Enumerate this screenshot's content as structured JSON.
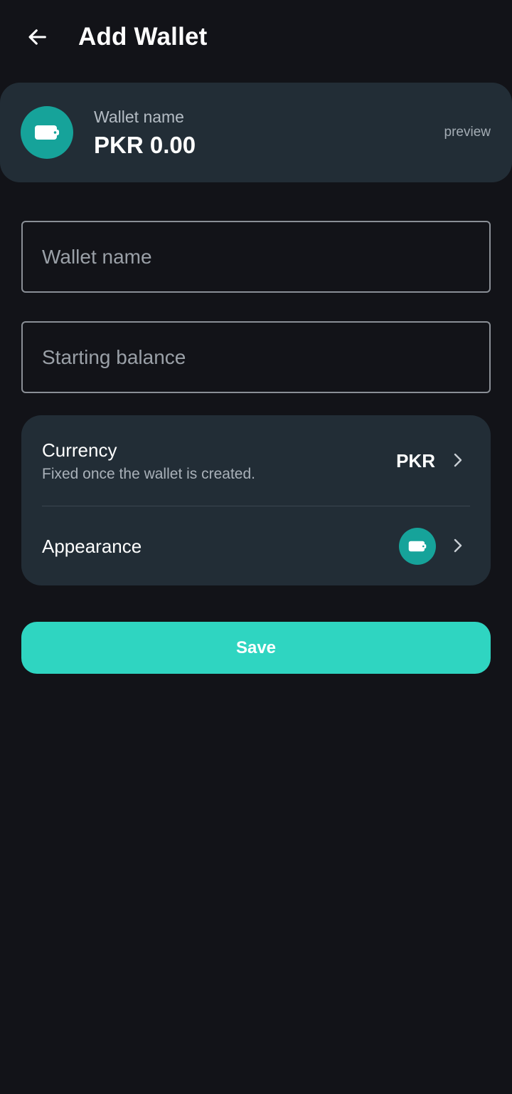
{
  "header": {
    "title": "Add Wallet",
    "back_icon": "arrow-left-icon"
  },
  "preview": {
    "name": "Wallet name",
    "balance": "PKR 0.00",
    "tag": "preview",
    "icon": "wallet-icon",
    "color": "#16a39a"
  },
  "form": {
    "name_placeholder": "Wallet name",
    "name_value": "",
    "balance_placeholder": "Starting balance",
    "balance_value": ""
  },
  "settings": {
    "currency_label": "Currency",
    "currency_hint": "Fixed once the wallet is created.",
    "currency_value": "PKR",
    "appearance_label": "Appearance",
    "appearance_color": "#16a39a",
    "appearance_icon": "wallet-icon"
  },
  "actions": {
    "save_label": "Save",
    "save_color": "#2fd5c1"
  }
}
